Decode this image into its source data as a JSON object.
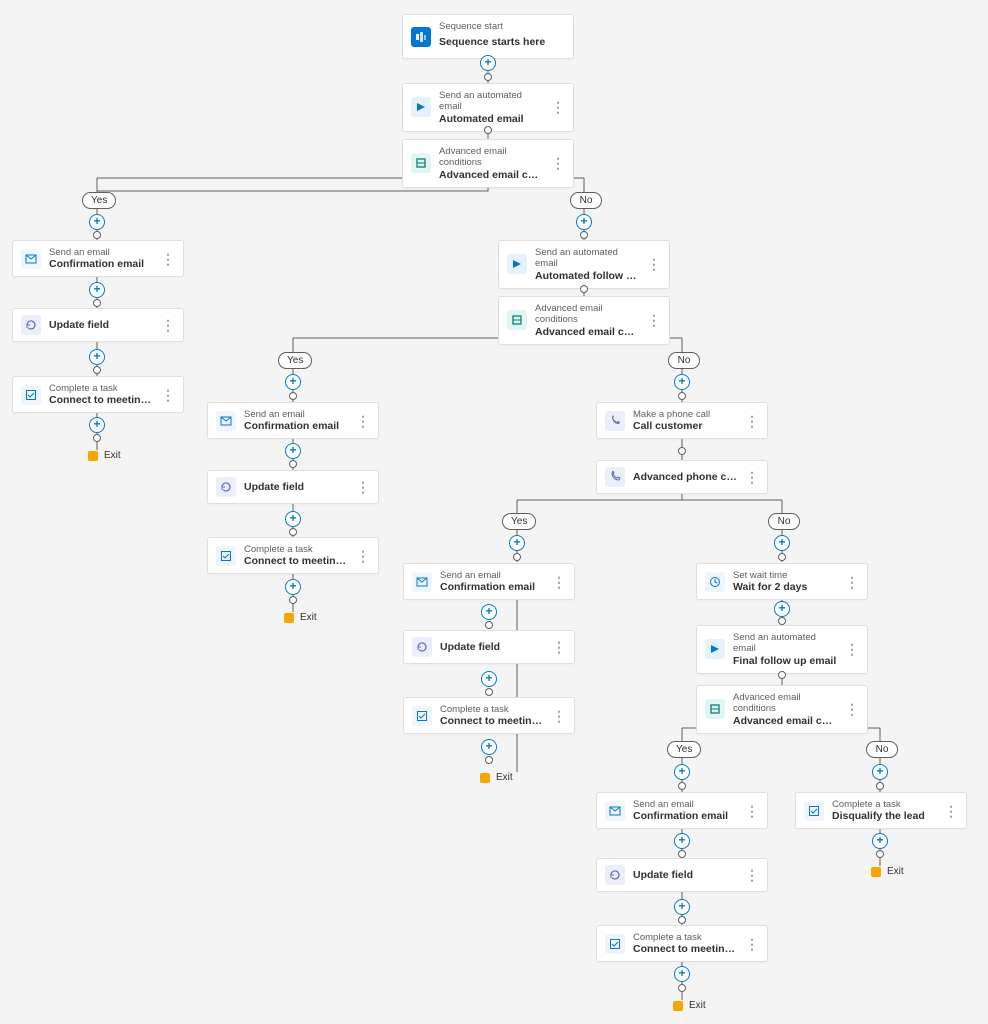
{
  "labels": {
    "yes": "Yes",
    "no": "No",
    "exit": "Exit"
  },
  "n": {
    "start": {
      "k": "Sequence start",
      "v": "Sequence starts here"
    },
    "auto1": {
      "k": "Send an automated email",
      "v": "Automated email"
    },
    "cond1": {
      "k": "Advanced email conditions",
      "v": "Advanced email conditions"
    },
    "conf1": {
      "k": "Send an email",
      "v": "Confirmation email"
    },
    "upd1": {
      "v": "Update field"
    },
    "task1": {
      "k": "Complete a task",
      "v": "Connect to meeting for product demo r..."
    },
    "auto2": {
      "k": "Send an automated email",
      "v": "Automated follow up email"
    },
    "cond2": {
      "k": "Advanced email conditions",
      "v": "Advanced email conditions"
    },
    "conf2": {
      "k": "Send an email",
      "v": "Confirmation email"
    },
    "upd2": {
      "v": "Update field"
    },
    "task2": {
      "k": "Complete a task",
      "v": "Connect to meeting for product demo r..."
    },
    "call": {
      "k": "Make a phone call",
      "v": "Call customer"
    },
    "phc": {
      "v": "Advanced phone condition"
    },
    "conf3": {
      "k": "Send an email",
      "v": "Confirmation email"
    },
    "upd3": {
      "v": "Update field"
    },
    "task3": {
      "k": "Complete a task",
      "v": "Connect to meeting for product demo r..."
    },
    "wait": {
      "k": "Set wait time",
      "v": "Wait for 2 days"
    },
    "auto3": {
      "k": "Send an automated email",
      "v": "Final follow up email"
    },
    "cond3": {
      "k": "Advanced email conditions",
      "v": "Advanced email conditions"
    },
    "conf4": {
      "k": "Send an email",
      "v": "Confirmation email"
    },
    "upd4": {
      "v": "Update field"
    },
    "task4": {
      "k": "Complete a task",
      "v": "Connect to meeting for product demo r..."
    },
    "disq": {
      "k": "Complete a task",
      "v": "Disqualify the lead"
    }
  }
}
